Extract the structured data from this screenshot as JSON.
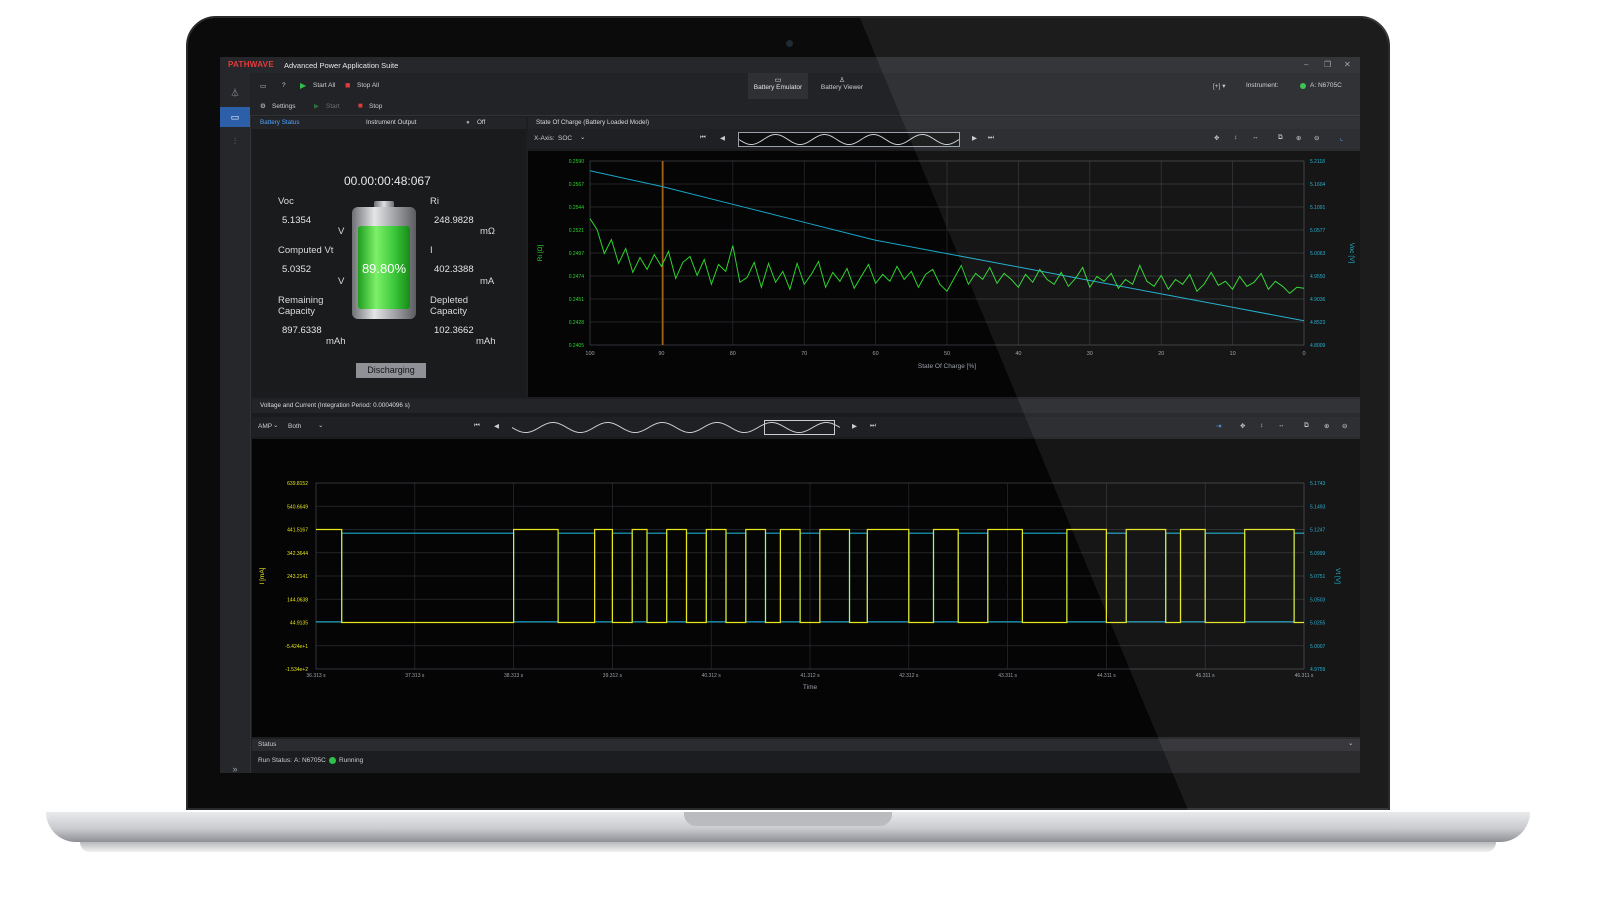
{
  "app": {
    "logo": "PATHWAVE",
    "title": "Advanced Power Application Suite",
    "window_controls": [
      "–",
      "❐",
      "✕"
    ]
  },
  "sidenav": {
    "expand": "»"
  },
  "toolbar": {
    "start_all": "Start All",
    "stop_all": "Stop All",
    "settings": "Settings",
    "start": "Start",
    "stop": "Stop",
    "tabs": [
      "Battery Emulator",
      "Battery Viewer"
    ],
    "instrument_label": "Instrument:",
    "instrument_value": "A: N6705C"
  },
  "battery_panel": {
    "tab_status": "Battery Status",
    "tab_output": "Instrument Output",
    "output_state": "Off",
    "timer": "00.00:00:48:067",
    "soc_percent": "89.80%",
    "soc_fraction": 0.898,
    "voc_label": "Voc",
    "voc_value": "5.1354",
    "voc_unit": "V",
    "cvt_label": "Computed Vt",
    "cvt_value": "5.0352",
    "cvt_unit": "V",
    "rem_label1": "Remaining",
    "rem_label2": "Capacity",
    "rem_value": "897.6338",
    "rem_unit": "mAh",
    "ri_label": "Ri",
    "ri_value": "248.9828",
    "ri_unit": "mΩ",
    "i_label": "I",
    "i_value": "402.3388",
    "i_unit": "mA",
    "dep_label1": "Depleted",
    "dep_label2": "Capacity",
    "dep_value": "102.3662",
    "dep_unit": "mAh",
    "discharging": "Discharging"
  },
  "soc_panel": {
    "title": "State Of Charge (Battery Loaded Model)",
    "xaxis_label": "X-Axis:",
    "xaxis_value": "SOC"
  },
  "vi_panel": {
    "title": "Voltage and Current (Integration Period: 0.0004096 s)",
    "amp_label": "AMP",
    "both_label": "Both"
  },
  "status": {
    "title": "Status",
    "run_status_label": "Run Status:",
    "instrument": "A: N6705C",
    "state": "Running"
  },
  "colors": {
    "green": "#2bd32b",
    "cyan": "#17a9c9",
    "yellow": "#e6e619",
    "accent": "#2c5fa8",
    "cursor": "#d07a1b"
  },
  "chart_data": [
    {
      "type": "line",
      "title": "",
      "xlabel": "State Of Charge [%]",
      "ylabel": "Ri [Ω]",
      "ylabel_right": "Voc [V]",
      "xlim": [
        100,
        0
      ],
      "x_ticks": [
        "100",
        "90",
        "80",
        "70",
        "60",
        "50",
        "40",
        "30",
        "20",
        "10",
        "0"
      ],
      "y_ticks_left": [
        "0.2590",
        "0.2567",
        "0.2544",
        "0.2521",
        "0.2497",
        "0.2474",
        "0.2451",
        "0.2428",
        "0.2405"
      ],
      "y_ticks_right": [
        "5.2118",
        "5.1604",
        "5.1091",
        "5.0577",
        "5.0063",
        "4.9550",
        "4.9036",
        "4.8523",
        "4.8009"
      ],
      "ylim_left": [
        0.2405,
        0.259
      ],
      "ylim_right": [
        4.8009,
        5.2118
      ],
      "grid": true,
      "cursor_x": 89.8,
      "series": [
        {
          "axis": "right",
          "color": "#17a9c9",
          "x": [
            100,
            90,
            80,
            70,
            60,
            50,
            40,
            30,
            20,
            10,
            0
          ],
          "y": [
            5.19,
            5.155,
            5.115,
            5.075,
            5.035,
            5.005,
            4.975,
            4.945,
            4.915,
            4.885,
            4.855
          ]
        },
        {
          "axis": "left",
          "color": "#2bd32b",
          "x": [
            100,
            99,
            98,
            97,
            96,
            95,
            94,
            93,
            92,
            91,
            90,
            89,
            88,
            87,
            86,
            85,
            84,
            83,
            82,
            81,
            80,
            79,
            78,
            77,
            76,
            75,
            74,
            73,
            72,
            71,
            70,
            69,
            68,
            67,
            66,
            65,
            64,
            63,
            62,
            61,
            60,
            59,
            58,
            57,
            56,
            55,
            54,
            53,
            52,
            51,
            50,
            49,
            48,
            47,
            46,
            45,
            44,
            43,
            42,
            41,
            40,
            39,
            38,
            37,
            36,
            35,
            34,
            33,
            32,
            31,
            30,
            29,
            28,
            27,
            26,
            25,
            24,
            23,
            22,
            21,
            20,
            19,
            18,
            17,
            16,
            15,
            14,
            13,
            12,
            11,
            10,
            9,
            8,
            7,
            6,
            5,
            4,
            3,
            2,
            1,
            0
          ],
          "y": [
            0.2532,
            0.2521,
            0.2497,
            0.2511,
            0.2487,
            0.2502,
            0.2478,
            0.2493,
            0.2481,
            0.2496,
            0.2484,
            0.2499,
            0.2472,
            0.2488,
            0.2494,
            0.2475,
            0.2491,
            0.2466,
            0.2486,
            0.2479,
            0.2505,
            0.2468,
            0.2473,
            0.2488,
            0.2463,
            0.2487,
            0.2468,
            0.2479,
            0.2461,
            0.2487,
            0.2466,
            0.2476,
            0.2489,
            0.2463,
            0.2478,
            0.2469,
            0.2482,
            0.2462,
            0.2474,
            0.2486,
            0.2467,
            0.2476,
            0.2469,
            0.2484,
            0.2471,
            0.2479,
            0.2463,
            0.2476,
            0.2481,
            0.2466,
            0.2459,
            0.2472,
            0.2485,
            0.2466,
            0.2477,
            0.2471,
            0.2483,
            0.2467,
            0.2477,
            0.2471,
            0.2463,
            0.2476,
            0.2468,
            0.2481,
            0.2471,
            0.2466,
            0.2478,
            0.2464,
            0.2472,
            0.2483,
            0.2463,
            0.2474,
            0.2469,
            0.2477,
            0.2462,
            0.2471,
            0.2466,
            0.2485,
            0.2469,
            0.2464,
            0.2475,
            0.2461,
            0.2471,
            0.2466,
            0.2476,
            0.2459,
            0.2466,
            0.2478,
            0.2465,
            0.2469,
            0.2461,
            0.2474,
            0.2464,
            0.2468,
            0.2477,
            0.2461,
            0.2469,
            0.2464,
            0.2457,
            0.2463,
            0.2462
          ]
        }
      ]
    },
    {
      "type": "line",
      "title": "",
      "xlabel": "Time",
      "ylabel": "I [mA]",
      "ylabel_right": "Vt [V]",
      "x_ticks": [
        "36.313 s",
        "37.313 s",
        "38.313 s",
        "39.312 s",
        "40.312 s",
        "41.312 s",
        "42.312 s",
        "43.311 s",
        "44.311 s",
        "45.311 s",
        "46.311 s"
      ],
      "y_ticks_left": [
        "639.8152",
        "540.6649",
        "441.5167",
        "342.3644",
        "243.2141",
        "144.0638",
        "44.9135",
        "-5.424e+1",
        "-1.534e+2"
      ],
      "y_ticks_right": [
        "5.1743",
        "5.1493",
        "5.1247",
        "5.0999",
        "5.0751",
        "5.0503",
        "5.0255",
        "5.0007",
        "4.9759"
      ],
      "ylim_left": [
        -153.4,
        639.8152
      ],
      "ylim_right": [
        4.9759,
        5.1743
      ],
      "grid": true,
      "series": [
        {
          "name": "",
          "axis": "left",
          "color": "#e6e619",
          "high_value": 441.5,
          "low_value": 44.9
        },
        {
          "name": "",
          "axis": "right",
          "color": "#17a9c9",
          "high_value": 5.1208,
          "low_value": 5.0262
        }
      ]
    }
  ]
}
